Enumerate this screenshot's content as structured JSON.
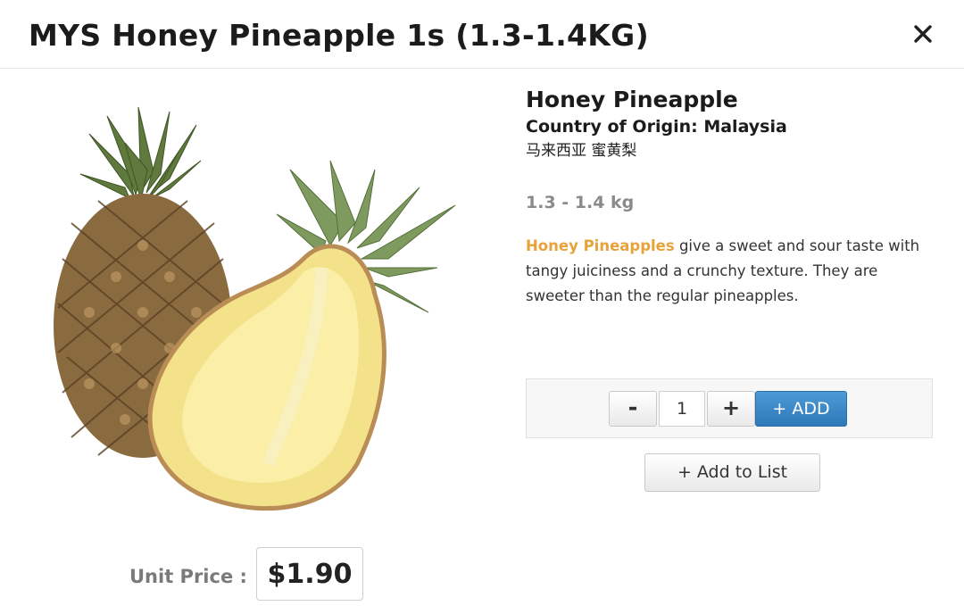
{
  "modal": {
    "title": "MYS Honey Pineapple 1s (1.3-1.4KG)",
    "close_icon": "close-icon"
  },
  "product": {
    "name": "Honey Pineapple",
    "origin": "Country of Origin: Malaysia",
    "chinese_name": "马来西亚 蜜黄梨",
    "weight": "1.3 - 1.4 kg",
    "description_highlight": "Honey Pineapples",
    "description_rest": " give a sweet and sour taste with tangy juiciness and a crunchy texture. They are sweeter than the regular pineapples.",
    "highlight_color": "#e8a23a"
  },
  "price": {
    "label": "Unit Price :",
    "value": "$1.90"
  },
  "cart": {
    "minus_label": "-",
    "quantity": "1",
    "plus_label": "+",
    "add_label": "+ ADD",
    "add_color": "#3a86c8"
  },
  "list": {
    "add_to_list_label": "+ Add to List"
  }
}
